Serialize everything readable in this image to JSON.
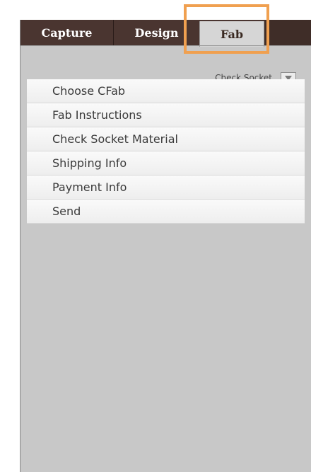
{
  "tabs": [
    "Capture",
    "Design",
    "Fab"
  ],
  "active_tab": "Fab",
  "check_socket": {
    "label": "Check Socket"
  },
  "menu": [
    "Choose CFab",
    "Fab Instructions",
    "Check Socket Material",
    "Shipping Info",
    "Payment Info",
    "Send"
  ],
  "colors": {
    "tabbar": "#4a3530",
    "active_tab": "#d6d6d6",
    "highlight": "#f0a050",
    "panel": "#c8c8c8"
  }
}
